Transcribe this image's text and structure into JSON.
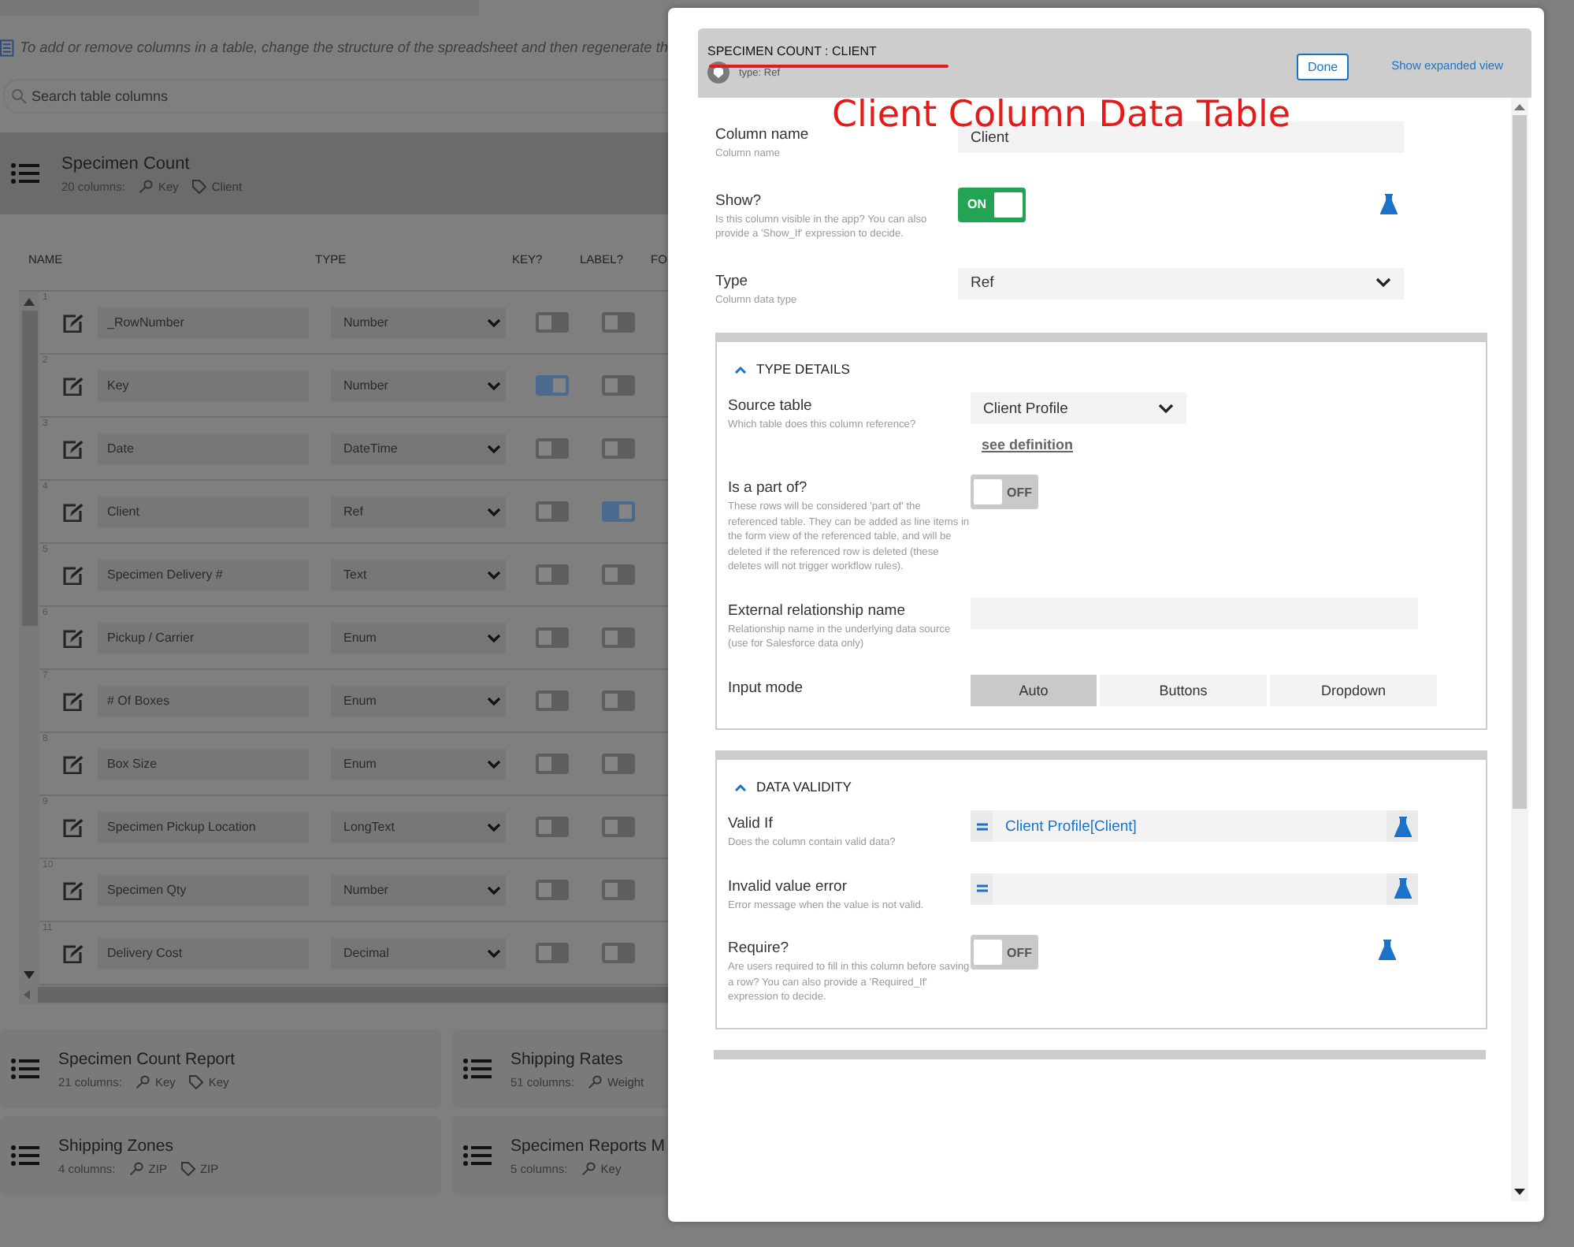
{
  "background": {
    "info_text": "To add or remove columns in a table, change the structure of the spreadsheet and then regenerate th",
    "search": {
      "placeholder": "Search table columns"
    },
    "table": {
      "name": "Specimen Count",
      "column_count": "20 columns:",
      "key": "Key",
      "label": "Client"
    },
    "column_headers": [
      "NAME",
      "TYPE",
      "KEY?",
      "LABEL?",
      "FO"
    ],
    "rows": [
      {
        "number": "1",
        "name": "_RowNumber",
        "type": "Number",
        "key": false,
        "label": false
      },
      {
        "number": "2",
        "name": "Key",
        "type": "Number",
        "key": true,
        "label": false
      },
      {
        "number": "3",
        "name": "Date",
        "type": "DateTime",
        "key": false,
        "label": false
      },
      {
        "number": "4",
        "name": "Client",
        "type": "Ref",
        "key": false,
        "label": true
      },
      {
        "number": "5",
        "name": "Specimen Delivery #",
        "type": "Text",
        "key": false,
        "label": false
      },
      {
        "number": "6",
        "name": "Pickup / Carrier",
        "type": "Enum",
        "key": false,
        "label": false
      },
      {
        "number": "7",
        "name": "# Of Boxes",
        "type": "Enum",
        "key": false,
        "label": false
      },
      {
        "number": "8",
        "name": "Box Size",
        "type": "Enum",
        "key": false,
        "label": false
      },
      {
        "number": "9",
        "name": "Specimen Pickup Location",
        "type": "LongText",
        "key": false,
        "label": false
      },
      {
        "number": "10",
        "name": "Specimen Qty",
        "type": "Number",
        "key": false,
        "label": false
      },
      {
        "number": "11",
        "name": "Delivery Cost",
        "type": "Decimal",
        "key": false,
        "label": false
      }
    ],
    "other_tables": [
      {
        "name": "Specimen Count Report",
        "column_count": "21 columns:",
        "key": "Key",
        "label": "Key"
      },
      {
        "name": "Shipping Rates",
        "column_count": "51 columns:",
        "key": "Weight"
      },
      {
        "name": "Shipping Zones",
        "column_count": "4 columns:",
        "key": "ZIP",
        "label": "ZIP"
      },
      {
        "name": "Specimen Reports M",
        "column_count": "5 columns:",
        "key": "Key"
      }
    ]
  },
  "dialog": {
    "title": "SPECIMEN COUNT : CLIENT",
    "subtitle": "type: Ref",
    "done": "Done",
    "expanded_link": "Show expanded view",
    "fields": [
      {
        "kind": "text",
        "label": "Column name",
        "hint": "Column name",
        "value": "Client"
      },
      {
        "kind": "toggle",
        "label": "Show?",
        "hint": "Is this column visible in the app? You can also provide a 'Show_If' expression to decide.",
        "on": true,
        "state_text": "ON",
        "flask": true
      },
      {
        "kind": "select",
        "label": "Type",
        "hint": "Column data type",
        "value": "Ref"
      }
    ],
    "sections": [
      {
        "title": "TYPE DETAILS",
        "expanded": true,
        "fields": [
          {
            "kind": "select",
            "label": "Source table",
            "hint": "Which table does this column reference?",
            "value": "Client Profile",
            "link": "see definition"
          },
          {
            "kind": "toggle",
            "label": "Is a part of?",
            "hint": "These rows will be considered 'part of' the referenced table. They can be added as line items in the form view of the referenced table, and will be deleted if the referenced row is deleted (these deletes will not trigger workflow rules).",
            "on": false,
            "state_text": "OFF",
            "flask": false
          },
          {
            "kind": "text",
            "label": "External relationship name",
            "hint": "Relationship name in the underlying data source (use for Salesforce data only)"
          },
          {
            "kind": "segmented",
            "label": "Input mode",
            "options": [
              {
                "label": "Auto",
                "selected": true
              },
              {
                "label": "Buttons",
                "selected": false
              },
              {
                "label": "Dropdown",
                "selected": false
              }
            ]
          }
        ]
      },
      {
        "title": "DATA VALIDITY",
        "expanded": true,
        "fields": [
          {
            "kind": "formula",
            "label": "Valid If",
            "hint": "Does the column contain valid data?",
            "value": "Client Profile[Client]"
          },
          {
            "kind": "formula",
            "label": "Invalid value error",
            "hint": "Error message when the value is not valid."
          },
          {
            "kind": "toggle",
            "label": "Require?",
            "hint": "Are users required to fill in this column before saving a row? You can also provide a 'Required_If' expression to decide.",
            "on": false,
            "state_text": "OFF",
            "flask": true
          }
        ]
      }
    ]
  },
  "annotation": {
    "text": "Client Column Data Table"
  }
}
